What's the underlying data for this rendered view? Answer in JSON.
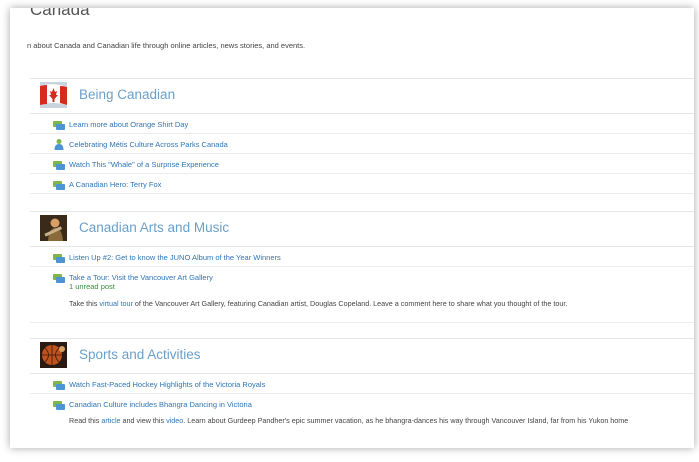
{
  "page": {
    "title": "Canada",
    "description": "n about Canada and Canadian life through online articles, news stories, and events."
  },
  "sections": [
    {
      "title": "Being Canadian",
      "thumb": "canada-flag",
      "items": [
        {
          "label": "Learn more about Orange Shirt Day",
          "icon": "forum-icon"
        },
        {
          "label": "Celebrating Métis Culture Across Parks Canada",
          "icon": "person-icon"
        },
        {
          "label": "Watch This \"Whale\" of a Surprise Experience",
          "icon": "forum-icon"
        },
        {
          "label": "A Canadian Hero: Terry Fox",
          "icon": "forum-icon"
        }
      ]
    },
    {
      "title": "Canadian Arts and Music",
      "thumb": "guitarist-photo",
      "items": [
        {
          "label": "Listen Up #2: Get to know the JUNO Album of the Year Winners",
          "icon": "forum-icon"
        },
        {
          "label": "Take a Tour: Visit the Vancouver Art Gallery",
          "icon": "forum-icon",
          "unread": "1 unread post",
          "desc_before": "Take this ",
          "desc_link": "virtual tour",
          "desc_after": " of the Vancouver Art Gallery, featuring Canadian artist, Douglas Copeland.  Leave a comment here to share what you thought of the tour."
        }
      ]
    },
    {
      "title": "Sports and Activities",
      "thumb": "basketball-photo",
      "items": [
        {
          "label": "Watch Fast-Paced Hockey Highlights of the Victoria Royals",
          "icon": "forum-icon"
        },
        {
          "label": "Canadian Culture includes Bhangra Dancing in Victoria",
          "icon": "forum-icon",
          "desc_before": "Read this ",
          "desc_link": "article",
          "desc_mid": " and view this ",
          "desc_link2": "video",
          "desc_after": ". Learn about Gurdeep Pandher's epic summer vacation, as he bhangra-dances his way through Vancouver Island, far from his Yukon home"
        }
      ]
    }
  ],
  "colors": {
    "section_title": "#6b9fc9",
    "link": "#2f75b5",
    "unread": "#3a8b3a"
  }
}
